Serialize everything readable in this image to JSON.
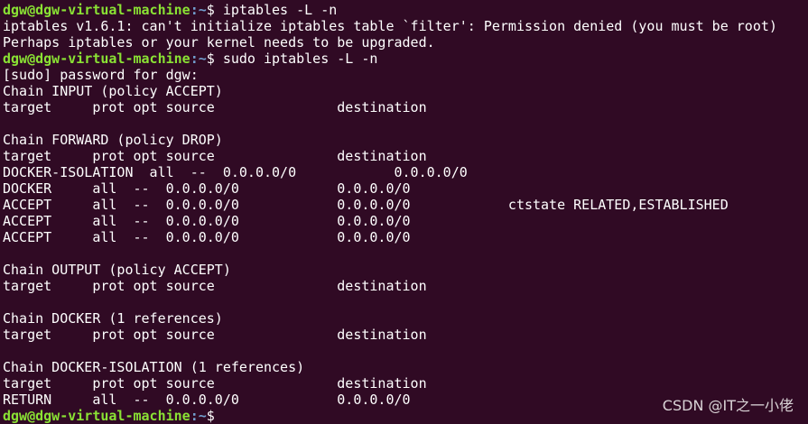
{
  "prompt": {
    "user_host": "dgw@dgw-virtual-machine",
    "path": ":~",
    "symbol": "$ "
  },
  "terminal": {
    "cmd1": "iptables -L -n",
    "err1": "iptables v1.6.1: can't initialize iptables table `filter': Permission denied (you must be root)",
    "err2": "Perhaps iptables or your kernel needs to be upgraded.",
    "cmd2": "sudo iptables -L -n",
    "sudo_prompt": "[sudo] password for dgw:",
    "input_chain": "Chain INPUT (policy ACCEPT)",
    "header": "target     prot opt source               destination",
    "forward_chain": "Chain FORWARD (policy DROP)",
    "forward_rows": [
      "DOCKER-ISOLATION  all  --  0.0.0.0/0            0.0.0.0/0",
      "DOCKER     all  --  0.0.0.0/0            0.0.0.0/0",
      "ACCEPT     all  --  0.0.0.0/0            0.0.0.0/0            ctstate RELATED,ESTABLISHED",
      "ACCEPT     all  --  0.0.0.0/0            0.0.0.0/0",
      "ACCEPT     all  --  0.0.0.0/0            0.0.0.0/0"
    ],
    "output_chain": "Chain OUTPUT (policy ACCEPT)",
    "docker_chain": "Chain DOCKER (1 references)",
    "isolation_chain": "Chain DOCKER-ISOLATION (1 references)",
    "isolation_rows": [
      "RETURN     all  --  0.0.0.0/0            0.0.0.0/0"
    ]
  },
  "watermark": "CSDN @IT之一小佬",
  "colors": {
    "background": "#300a24",
    "text": "#ffffff",
    "prompt_user": "#8ae234",
    "prompt_path": "#729fcf"
  }
}
